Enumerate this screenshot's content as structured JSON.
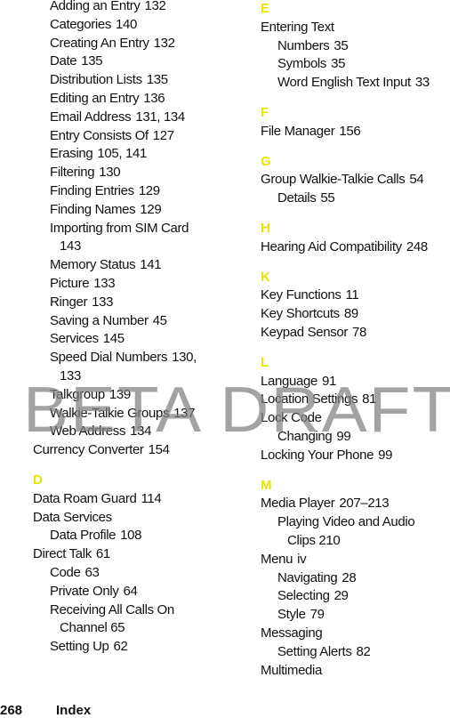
{
  "left_column": [
    {
      "type": "sub",
      "text": "Adding an Entry",
      "page": "132"
    },
    {
      "type": "sub",
      "text": "Categories",
      "page": "140"
    },
    {
      "type": "sub",
      "text": "Creating An Entry",
      "page": "132"
    },
    {
      "type": "sub",
      "text": "Date",
      "page": "135"
    },
    {
      "type": "sub",
      "text": "Distribution Lists",
      "page": "135"
    },
    {
      "type": "sub",
      "text": "Editing an Entry",
      "page": "136"
    },
    {
      "type": "sub",
      "text": "Email Address",
      "page": "131, 134"
    },
    {
      "type": "sub",
      "text": "Entry Consists Of",
      "page": "127"
    },
    {
      "type": "sub",
      "text": "Erasing",
      "page": "105, 141"
    },
    {
      "type": "sub",
      "text": "Filtering",
      "page": "130"
    },
    {
      "type": "sub",
      "text": "Finding Entries",
      "page": "129"
    },
    {
      "type": "sub",
      "text": "Finding Names",
      "page": "129"
    },
    {
      "type": "subwrap",
      "text": "Importing from SIM Card",
      "page": "143"
    },
    {
      "type": "sub",
      "text": "Memory Status",
      "page": "141"
    },
    {
      "type": "sub",
      "text": "Picture",
      "page": "133"
    },
    {
      "type": "sub",
      "text": "Ringer",
      "page": "133"
    },
    {
      "type": "sub",
      "text": "Saving a Number",
      "page": "45"
    },
    {
      "type": "sub",
      "text": "Services",
      "page": "145"
    },
    {
      "type": "subwrap",
      "text": "Speed Dial Numbers",
      "page": "130,",
      "cont": "133"
    },
    {
      "type": "sub",
      "text": "Talkgroup",
      "page": "139"
    },
    {
      "type": "sub",
      "text": "Walkie-Talkie Groups",
      "page": "137"
    },
    {
      "type": "sub",
      "text": "Web Address",
      "page": "134"
    },
    {
      "type": "main",
      "text": "Currency Converter",
      "page": "154"
    },
    {
      "type": "letter",
      "text": "D"
    },
    {
      "type": "main",
      "text": "Data Roam Guard",
      "page": "114"
    },
    {
      "type": "main",
      "text": "Data Services",
      "page": ""
    },
    {
      "type": "sub",
      "text": "Data Profile",
      "page": "108"
    },
    {
      "type": "main",
      "text": "Direct Talk",
      "page": "61"
    },
    {
      "type": "sub",
      "text": "Code",
      "page": "63"
    },
    {
      "type": "sub",
      "text": "Private Only",
      "page": "64"
    },
    {
      "type": "subwrap",
      "text": "Receiving All Calls On",
      "page": "",
      "cont": "Channel  65"
    },
    {
      "type": "sub",
      "text": "Setting Up",
      "page": "62"
    }
  ],
  "right_column": [
    {
      "type": "letter",
      "text": "E"
    },
    {
      "type": "main",
      "text": "Entering Text",
      "page": ""
    },
    {
      "type": "sub",
      "text": "Numbers",
      "page": "35"
    },
    {
      "type": "sub",
      "text": "Symbols",
      "page": "35"
    },
    {
      "type": "sub",
      "text": "Word English Text Input",
      "page": "33"
    },
    {
      "type": "letter",
      "text": "F"
    },
    {
      "type": "main",
      "text": "File Manager",
      "page": "156"
    },
    {
      "type": "letter",
      "text": "G"
    },
    {
      "type": "main",
      "text": "Group Walkie-Talkie Calls",
      "page": "54"
    },
    {
      "type": "sub",
      "text": "Details",
      "page": "55"
    },
    {
      "type": "letter",
      "text": "H"
    },
    {
      "type": "main",
      "text": "Hearing Aid Compatibility",
      "page": "248"
    },
    {
      "type": "letter",
      "text": "K"
    },
    {
      "type": "main",
      "text": "Key Functions",
      "page": "11"
    },
    {
      "type": "main",
      "text": "Key Shortcuts",
      "page": "89"
    },
    {
      "type": "main",
      "text": "Keypad Sensor",
      "page": "78"
    },
    {
      "type": "letter",
      "text": "L"
    },
    {
      "type": "main",
      "text": "Language",
      "page": "91"
    },
    {
      "type": "main",
      "text": "Location Settings",
      "page": "81"
    },
    {
      "type": "main",
      "text": "Lock Code",
      "page": ""
    },
    {
      "type": "sub",
      "text": "Changing",
      "page": "99"
    },
    {
      "type": "main",
      "text": "Locking Your Phone",
      "page": "99"
    },
    {
      "type": "letter",
      "text": "M"
    },
    {
      "type": "main",
      "text": "Media Player",
      "page": "207–213"
    },
    {
      "type": "subwrap",
      "text": "Playing Video and Audio",
      "page": "",
      "cont": "Clips  210"
    },
    {
      "type": "main",
      "text": "Menu",
      "page": "iv"
    },
    {
      "type": "sub",
      "text": "Navigating",
      "page": "28"
    },
    {
      "type": "sub",
      "text": "Selecting",
      "page": "29"
    },
    {
      "type": "sub",
      "text": "Style",
      "page": "79"
    },
    {
      "type": "main",
      "text": "Messaging",
      "page": ""
    },
    {
      "type": "sub",
      "text": "Setting Alerts",
      "page": "82"
    },
    {
      "type": "main",
      "text": "Multimedia",
      "page": ""
    }
  ],
  "watermark": "BETA DRAFT",
  "footer": {
    "page_number": "268",
    "section": "Index"
  },
  "colors": {
    "letter_heading": "#e6e600",
    "watermark": "#808080",
    "text": "#111111"
  }
}
